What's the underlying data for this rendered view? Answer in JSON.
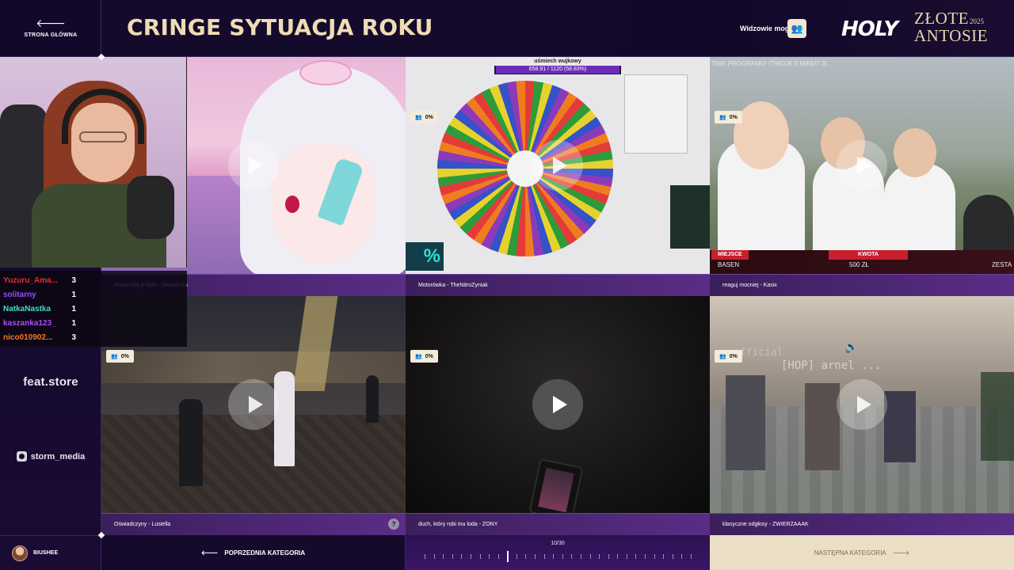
{
  "nav": {
    "home_label": "STRONA GŁÓWNA",
    "prev_label": "POPRZEDNIA KATEGORIA",
    "next_label": "NASTĘPNA KATEGORIA",
    "progress": "10/30",
    "progress_current": 10,
    "progress_total": 30
  },
  "header": {
    "title": "CRINGE SYTUACJA ROKU",
    "viewers_label": "Widzowie mogą",
    "logo_holy": "HOLY",
    "logo_zlote": "ZŁOTE",
    "logo_antosie": "ANTOSIE",
    "logo_year": "2025"
  },
  "sponsors": {
    "feat": "feat.store",
    "storm": "storm_media"
  },
  "user": {
    "name": "BIUSHEE"
  },
  "leaderboard": [
    {
      "nick": "Yuzuru_Ama...",
      "count": "3",
      "color": "#e0332f"
    },
    {
      "nick": "solitarny",
      "count": "1",
      "color": "#9b4dff"
    },
    {
      "nick": "NatkaNastka",
      "count": "1",
      "color": "#3de0c0"
    },
    {
      "nick": "kaszanka123_",
      "count": "1",
      "color": "#b04aff"
    },
    {
      "nick": "nico010902...",
      "count": "3",
      "color": "#f07a2a"
    }
  ],
  "tiles": [
    {
      "caption": "dewiandia je loda - Dewiandia",
      "viewers": "0%"
    },
    {
      "caption": "Motorówka - TheNitroZyniak",
      "viewers": "0%",
      "overlay_title": "uśmiech wujkowy",
      "overlay_progress": "658.91 / 1120 (58.83%)",
      "overlay_fraction": 0.5883
    },
    {
      "caption": "reaguj mocniej - Kasix",
      "viewers": "0%",
      "toptext": "TNIK PROGRAMU! (TWOJE 5 MINUT 3)",
      "label_a": "MIEJSCE",
      "value_a": "BASEN",
      "label_b": "KWOTA",
      "value_b": "500 ZŁ",
      "value_c": "ZESTA"
    },
    {
      "caption": "Oświadczyny - Lusiella",
      "viewers": "0%"
    },
    {
      "caption": "duch, który robi mu loda - ZONY",
      "viewers": "0%"
    },
    {
      "caption": "klasyczne odgłosy - ZWIERZAAAK",
      "viewers": "0%",
      "mc_text": "[HOP] arnel ...",
      "mc_text2": "official"
    }
  ],
  "icons": {
    "home": "arrow-left-icon",
    "viewers": "users-icon",
    "play": "play-icon",
    "help": "help-icon",
    "mute": "speaker-icon"
  },
  "colors": {
    "accent": "#efdcb4",
    "caption_bg": "#4a2470",
    "badge_bg": "#f3ecd9"
  }
}
